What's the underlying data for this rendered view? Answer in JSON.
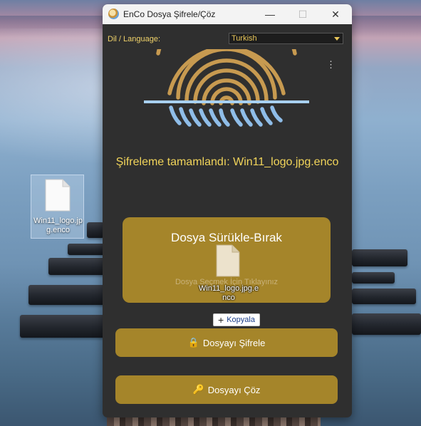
{
  "desktop": {
    "file_icon_label": "Win11_logo.jpg.enco"
  },
  "window": {
    "title": "EnCo Dosya Şifrele/Çöz",
    "controls": {
      "minimize": "—",
      "maximize": "☐",
      "close": "✕"
    }
  },
  "language": {
    "label": "Dil / Language:",
    "selected": "Turkish"
  },
  "menu": {
    "kebab": "⋮"
  },
  "status_message": "Şifreleme tamamlandı: Win11_logo.jpg.enco",
  "drop_zone": {
    "title": "Dosya Sürükle-Bırak",
    "hint": "Dosya Seçmek İçin Tıklayınız",
    "dragged_file_label": "Win11_logo.jpg.enco",
    "copy_badge_label": "Kopyala",
    "copy_badge_icon": "+"
  },
  "buttons": {
    "encrypt_label": "Dosyayı Şifrele",
    "encrypt_icon": "🔒",
    "decrypt_label": "Dosyayı Çöz",
    "decrypt_icon": "🔑"
  },
  "colors": {
    "accent": "#a5852a",
    "status_text": "#f1d45a",
    "window_bg": "#2f2f2f"
  }
}
